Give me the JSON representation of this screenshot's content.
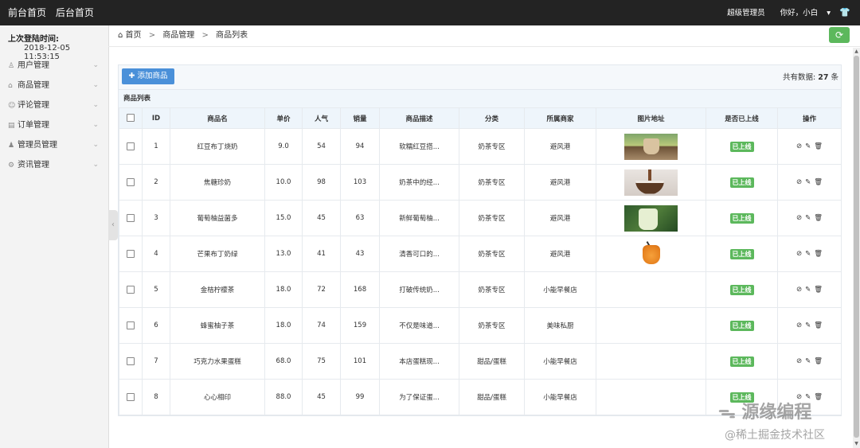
{
  "topbar": {
    "nav": [
      "前台首页",
      "后台首页"
    ],
    "admin_role": "超级管理员",
    "greeting": "你好，小白",
    "chevron": "▾"
  },
  "sidebar": {
    "last_login_label": "上次登陆时间:",
    "last_login_time": "2018-12-05 11:53:15",
    "items": [
      {
        "label": "用户管理",
        "icon": "user-icon"
      },
      {
        "label": "商品管理",
        "icon": "bag-icon"
      },
      {
        "label": "评论管理",
        "icon": "comment-icon"
      },
      {
        "label": "订单管理",
        "icon": "order-icon"
      },
      {
        "label": "管理员管理",
        "icon": "admin-icon"
      },
      {
        "label": "资讯管理",
        "icon": "gear-icon"
      }
    ]
  },
  "breadcrumb": {
    "home": "首页",
    "level1": "商品管理",
    "level2": "商品列表",
    "separator": ">"
  },
  "toolbar": {
    "add_label": "添加商品",
    "total_prefix": "共有数据:",
    "total_count": "27",
    "total_suffix": "条"
  },
  "list_title": "商品列表",
  "table": {
    "headers": [
      "ID",
      "商品名",
      "单价",
      "人气",
      "销量",
      "商品描述",
      "分类",
      "所属商家",
      "图片地址",
      "是否已上线",
      "操作"
    ],
    "rows": [
      {
        "id": "1",
        "name": "红豆布丁烧奶",
        "price": "9.0",
        "popularity": "54",
        "sales": "94",
        "desc": "软糯红豆搭...",
        "category": "奶茶专区",
        "merchant": "避风港",
        "status": "已上线"
      },
      {
        "id": "2",
        "name": "焦糖珍奶",
        "price": "10.0",
        "popularity": "98",
        "sales": "103",
        "desc": "奶茶中的经...",
        "category": "奶茶专区",
        "merchant": "避风港",
        "status": "已上线"
      },
      {
        "id": "3",
        "name": "葡萄柚益菌多",
        "price": "15.0",
        "popularity": "45",
        "sales": "63",
        "desc": "新鲜葡萄柚...",
        "category": "奶茶专区",
        "merchant": "避风港",
        "status": "已上线"
      },
      {
        "id": "4",
        "name": "芒果布丁奶绿",
        "price": "13.0",
        "popularity": "41",
        "sales": "43",
        "desc": "清香可口的...",
        "category": "奶茶专区",
        "merchant": "避风港",
        "status": "已上线"
      },
      {
        "id": "5",
        "name": "金桔柠檬茶",
        "price": "18.0",
        "popularity": "72",
        "sales": "168",
        "desc": "打破传统奶...",
        "category": "奶茶专区",
        "merchant": "小能早餐店",
        "status": "已上线"
      },
      {
        "id": "6",
        "name": "蜂蜜柚子茶",
        "price": "18.0",
        "popularity": "74",
        "sales": "159",
        "desc": "不仅是味道...",
        "category": "奶茶专区",
        "merchant": "美味私厨",
        "status": "已上线"
      },
      {
        "id": "7",
        "name": "巧克力水果蛋糕",
        "price": "68.0",
        "popularity": "75",
        "sales": "101",
        "desc": "本店蛋糕现...",
        "category": "甜品/蛋糕",
        "merchant": "小能早餐店",
        "status": "已上线"
      },
      {
        "id": "8",
        "name": "心心相印",
        "price": "88.0",
        "popularity": "45",
        "sales": "99",
        "desc": "为了保证蛋...",
        "category": "甜品/蛋糕",
        "merchant": "小能早餐店",
        "status": "已上线"
      }
    ]
  },
  "watermark": {
    "line1": "源缘编程",
    "line2": "@稀土掘金技术社区"
  }
}
